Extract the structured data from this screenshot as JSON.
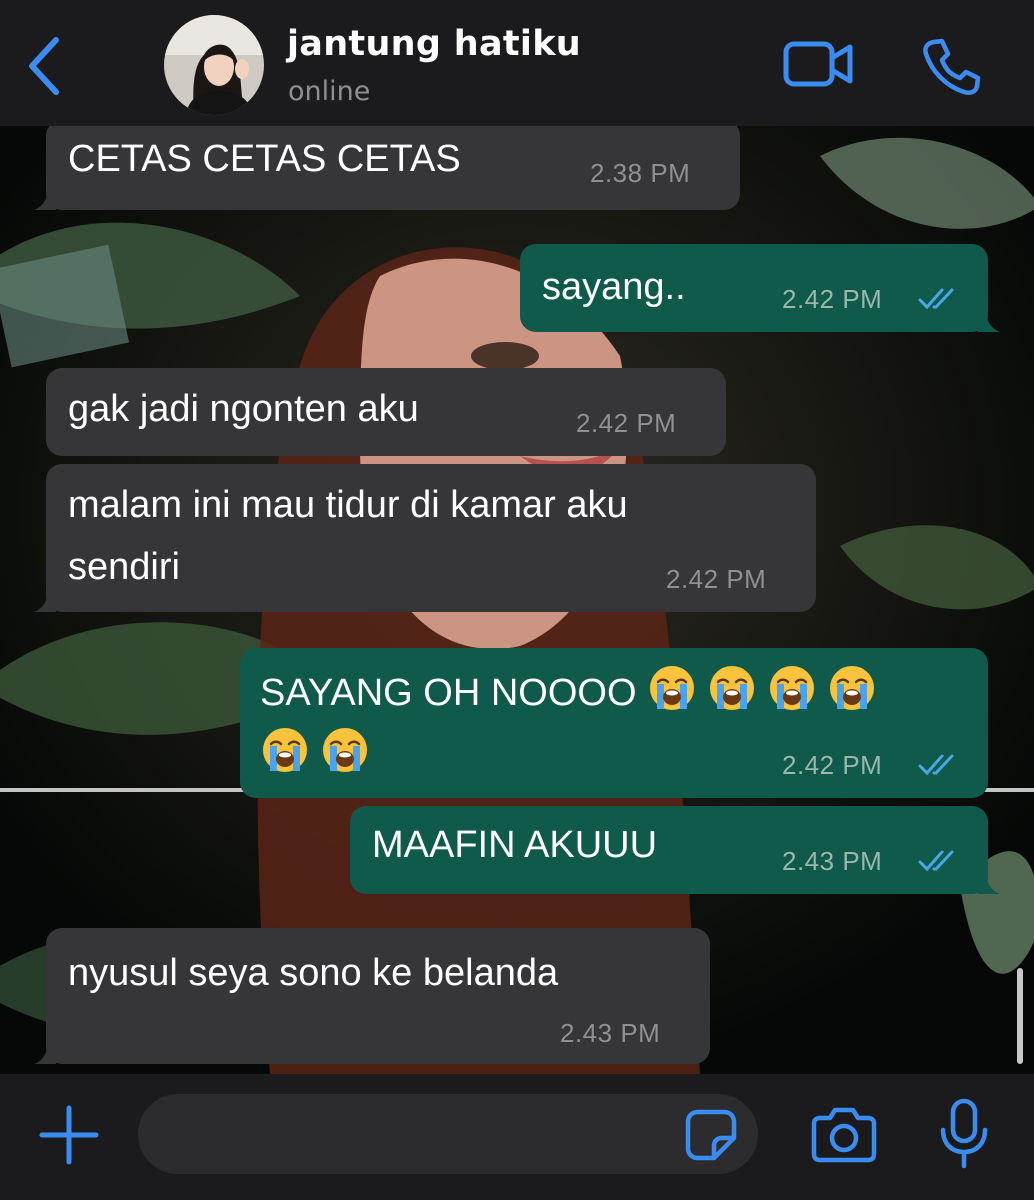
{
  "header": {
    "contact_name": "jantung hatiku",
    "status": "online",
    "back_icon": "chevron-left-icon",
    "video_icon": "video-camera-icon",
    "call_icon": "phone-icon"
  },
  "messages": [
    {
      "direction": "incoming",
      "lines": [
        "CETAS CETAS CETAS"
      ],
      "time": "2.38 PM"
    },
    {
      "direction": "outgoing",
      "lines": [
        "sayang.."
      ],
      "time": "2.42 PM",
      "status": "read"
    },
    {
      "direction": "incoming",
      "lines": [
        "gak jadi ngonten aku"
      ],
      "time": "2.42 PM"
    },
    {
      "direction": "incoming",
      "lines": [
        "malam ini mau tidur di kamar aku",
        "sendiri"
      ],
      "time": "2.42 PM"
    },
    {
      "direction": "outgoing",
      "lines": [
        "SAYANG OH NOOOO",
        ""
      ],
      "emoji": "loudly-crying-face",
      "emoji_line1_count": 4,
      "emoji_line2_count": 2,
      "time": "2.42 PM",
      "status": "read"
    },
    {
      "direction": "outgoing",
      "lines": [
        "MAAFIN AKUUU"
      ],
      "time": "2.43 PM",
      "status": "read"
    },
    {
      "direction": "incoming",
      "lines": [
        "nyusul seya sono ke belanda"
      ],
      "time": "2.43 PM"
    }
  ],
  "composer": {
    "placeholder": "",
    "plus_icon": "plus-icon",
    "sticker_icon": "sticker-icon",
    "camera_icon": "camera-icon",
    "mic_icon": "microphone-icon"
  },
  "colors": {
    "accent": "#3b8cf0",
    "incoming_bubble": "#363638",
    "outgoing_bubble": "#0f5a4b",
    "bar_background": "#1b1b1d",
    "read_ticks": "#4aa6e8"
  }
}
